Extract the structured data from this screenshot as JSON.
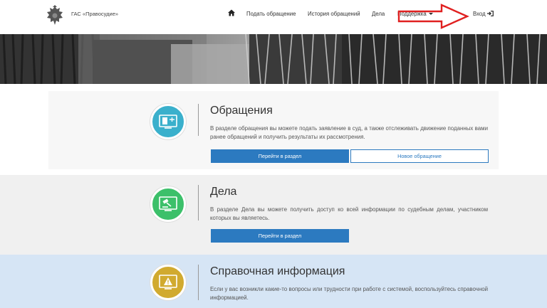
{
  "header": {
    "brand": "ГАС «Правосудие»",
    "nav": {
      "submit": "Подать обращение",
      "history": "История обращений",
      "cases": "Дела",
      "support": "Поддержка",
      "login": "Вход"
    }
  },
  "sections": [
    {
      "title": "Обращения",
      "text": "В разделе обращения вы можете подать заявление в суд, а также отслеживать движение поданных вами ранее обращений и получить результаты их рассмотрения.",
      "primary_button": "Перейти в раздел",
      "secondary_button": "Новое обращение",
      "icon": "document-screen-icon",
      "color": "#3ab0cc"
    },
    {
      "title": "Дела",
      "text": "В разделе Дела вы можете получить доступ ко всей информации по судебным делам, участником которых вы являетесь.",
      "primary_button": "Перейти в раздел",
      "icon": "gavel-screen-icon",
      "color": "#3cc06a"
    },
    {
      "title": "Справочная информация",
      "text": "Если у вас возникли какие-то вопросы или трудности при работе с системой, воспользуйтесь справочной информацией.",
      "icon": "warning-screen-icon",
      "color": "#d1aa2f"
    }
  ],
  "colors": {
    "accent": "#2c7ac0",
    "annotation": "#e02020"
  }
}
